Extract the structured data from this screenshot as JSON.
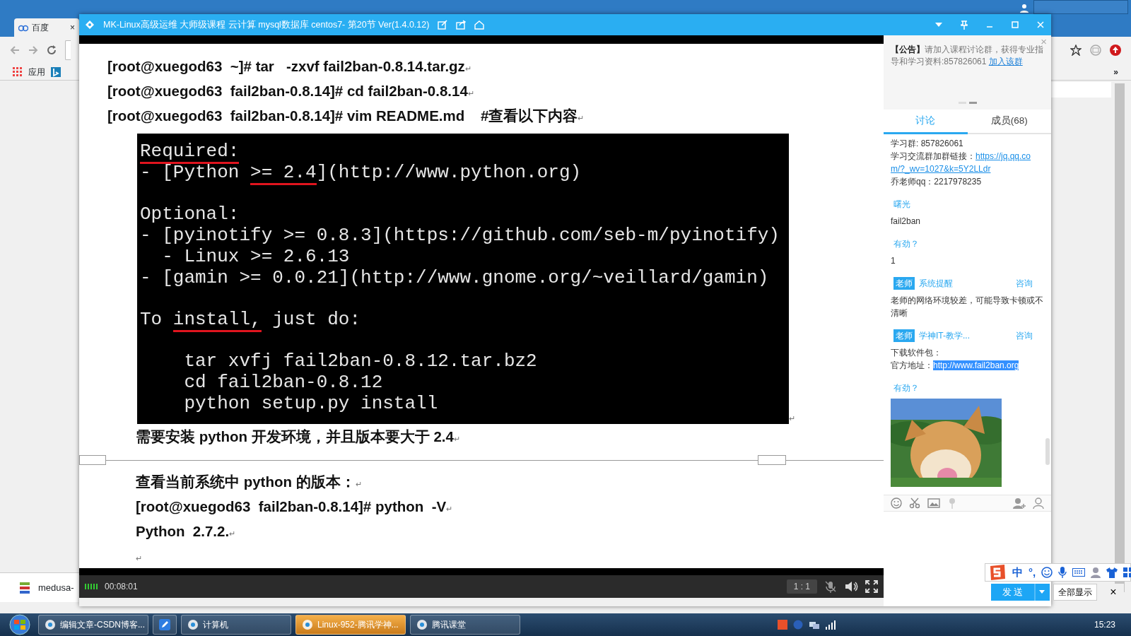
{
  "browser": {
    "tab": {
      "label": "百度",
      "close": "×"
    },
    "bookmarks": [
      {
        "label": "应用"
      }
    ],
    "more": "»",
    "download": {
      "label": "medusa-"
    }
  },
  "player": {
    "title": "MK-Linux高级运维 大师级课程 云计算 mysql数据库 centos7- 第20节 Ver(1.4.0.12)",
    "document": {
      "blocks": [
        {
          "kind": "text",
          "indented": false,
          "text": "[root@xuegod63  ~]# tar   -zxvf fail2ban-0.8.14.tar.gz",
          "mark": "↵"
        },
        {
          "kind": "text",
          "indented": false,
          "text": "[root@xuegod63  fail2ban-0.8.14]# cd fail2ban-0.8.14",
          "mark": "↵"
        },
        {
          "kind": "text",
          "indented": false,
          "text": "[root@xuegod63  fail2ban-0.8.14]# vim README.md    #查看以下内容",
          "mark": "↵"
        },
        {
          "kind": "terminal",
          "mark": "↵",
          "lines": [
            {
              "blank_before": false,
              "parts": [
                {
                  "text": "Required:",
                  "marked": true
                }
              ]
            },
            {
              "blank_before": false,
              "parts": [
                {
                  "text": "- [Python ",
                  "marked": false
                },
                {
                  "text": ">= 2.4",
                  "marked": true
                },
                {
                  "text": "](http://www.python.org)",
                  "marked": false
                }
              ]
            },
            {
              "blank_before": true,
              "parts": [
                {
                  "text": "Optional:",
                  "marked": false
                }
              ]
            },
            {
              "blank_before": false,
              "parts": [
                {
                  "text": "- [pyinotify >= 0.8.3](https://github.com/seb-m/pyinotify)",
                  "marked": false
                }
              ]
            },
            {
              "blank_before": false,
              "parts": [
                {
                  "text": "  - Linux >= 2.6.13",
                  "marked": false
                }
              ]
            },
            {
              "blank_before": false,
              "parts": [
                {
                  "text": "- [gamin >= 0.0.21](http://www.gnome.org/~veillard/gamin)",
                  "marked": false
                }
              ]
            },
            {
              "blank_before": true,
              "parts": [
                {
                  "text": "To ",
                  "marked": false
                },
                {
                  "text": "install,",
                  "marked": true
                },
                {
                  "text": " just do:",
                  "marked": false
                }
              ]
            },
            {
              "blank_before": true,
              "parts": [
                {
                  "text": "    tar xvfj fail2ban-0.8.12.tar.bz2",
                  "marked": false
                }
              ]
            },
            {
              "blank_before": false,
              "parts": [
                {
                  "text": "    cd fail2ban-0.8.12",
                  "marked": false
                }
              ]
            },
            {
              "blank_before": false,
              "parts": [
                {
                  "text": "    python setup.py install",
                  "marked": false
                }
              ]
            }
          ]
        },
        {
          "kind": "text",
          "indented": true,
          "text": "需要安装 python 开发环境，并且版本要大于 2.4",
          "mark": "↵"
        },
        {
          "kind": "page_break"
        },
        {
          "kind": "text",
          "indented": true,
          "text": "查看当前系统中 python 的版本：",
          "mark": "↵"
        },
        {
          "kind": "text",
          "indented": true,
          "text": "[root@xuegod63  fail2ban-0.8.14]# python  -V",
          "mark": "↵"
        },
        {
          "kind": "text",
          "indented": true,
          "text": "Python  2.7.2.",
          "mark": "↵"
        },
        {
          "kind": "text",
          "indented": true,
          "mark": "↵"
        }
      ]
    },
    "elapsed": "00:08:01",
    "ratio": "1 : 1"
  },
  "panel": {
    "notice": {
      "title": "【公告】",
      "text": "请加入课程讨论群，获得专业指导和学习资料:857826061",
      "link": "加入该群",
      "close": "×",
      "slides": [
        {
          "selected": false
        },
        {
          "selected": true
        }
      ]
    },
    "tabs": [
      {
        "label": "讨论",
        "selected": true
      },
      {
        "label": "成员(68)",
        "selected": false
      }
    ],
    "messages": [
      {
        "kind": "text",
        "lines": [
          [
            {
              "text": "学习群: 857826061",
              "kind": "plain"
            }
          ],
          [
            {
              "text": "学习交流群加群链接：",
              "kind": "plain"
            },
            {
              "text": "https://jq.qq.com/?_wv=1027&k=5Y2LLdr",
              "kind": "link"
            }
          ],
          [
            {
              "text": "乔老师qq：2217978235",
              "kind": "plain"
            }
          ]
        ]
      },
      {
        "kind": "text",
        "sender": "曙光",
        "lines": [
          [
            {
              "text": "fail2ban",
              "kind": "plain"
            }
          ]
        ]
      },
      {
        "kind": "text",
        "sender": "有劲？",
        "lines": [
          [
            {
              "text": "1",
              "kind": "plain"
            }
          ]
        ]
      },
      {
        "kind": "text",
        "badge": "老师",
        "sender": "系统提醒",
        "action": "咨询",
        "lines": [
          [
            {
              "text": "老师的网络环境较差，可能导致卡顿或不清晰",
              "kind": "plain"
            }
          ]
        ]
      },
      {
        "kind": "text",
        "badge": "老师",
        "sender": "学神IT-教学...",
        "action": "咨询",
        "lines": [
          [
            {
              "text": "下载软件包：",
              "kind": "plain"
            }
          ],
          [
            {
              "text": "官方地址：",
              "kind": "plain"
            },
            {
              "text": "http://www.fail2ban.org",
              "kind": "selected"
            }
          ]
        ]
      },
      {
        "kind": "picture",
        "sender": "有劲？"
      }
    ],
    "send": "发 送",
    "show_all": "全部显示",
    "close": "×"
  },
  "ime": {
    "mode": "中",
    "punct": "°,"
  },
  "taskbar": {
    "items": [
      {
        "kind": "window",
        "label": "编辑文章-CSDN博客...",
        "flashing": false
      },
      {
        "kind": "icon"
      },
      {
        "kind": "window",
        "label": "计算机",
        "flashing": false
      },
      {
        "kind": "window",
        "label": "Linux-952-腾讯学神...",
        "flashing": true
      },
      {
        "kind": "window",
        "label": "腾讯课堂",
        "flashing": false
      }
    ],
    "time": "15:23"
  }
}
